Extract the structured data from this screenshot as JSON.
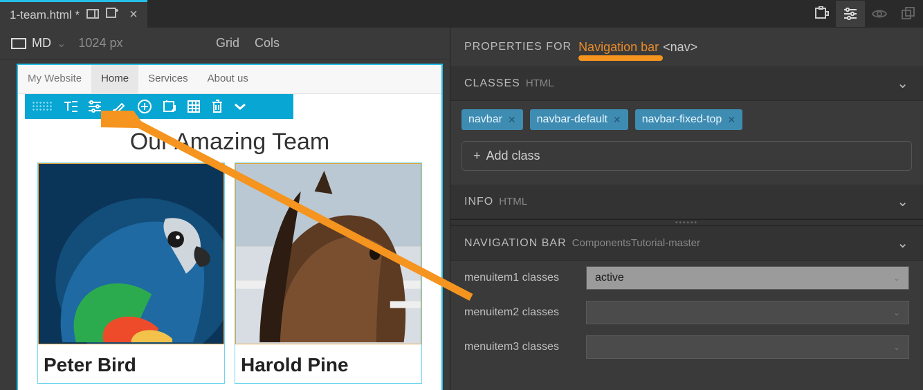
{
  "tab": {
    "filename": "1-team.html *"
  },
  "breakpoint": {
    "label": "MD",
    "width": "1024 px"
  },
  "grid_label": "Grid",
  "cols_label": "Cols",
  "site": {
    "brand": "My Website",
    "nav": [
      "Home",
      "Services",
      "About us"
    ],
    "heading": "Our Amazing Team",
    "cards": [
      {
        "name": "Peter Bird"
      },
      {
        "name": "Harold Pine"
      }
    ]
  },
  "panel": {
    "properties_for": "PROPERTIES FOR",
    "element_name": "Navigation bar",
    "element_tag": "<nav>",
    "classes_label": "CLASSES",
    "classes_sub": "HTML",
    "chips": [
      "navbar",
      "navbar-default",
      "navbar-fixed-top"
    ],
    "add_class": "Add class",
    "info_label": "INFO",
    "info_sub": "HTML",
    "component_label": "NAVIGATION BAR",
    "component_source": "ComponentsTutorial-master",
    "rows": [
      {
        "label": "menuitem1 classes",
        "value": "active"
      },
      {
        "label": "menuitem2 classes",
        "value": ""
      },
      {
        "label": "menuitem3 classes",
        "value": ""
      }
    ]
  }
}
